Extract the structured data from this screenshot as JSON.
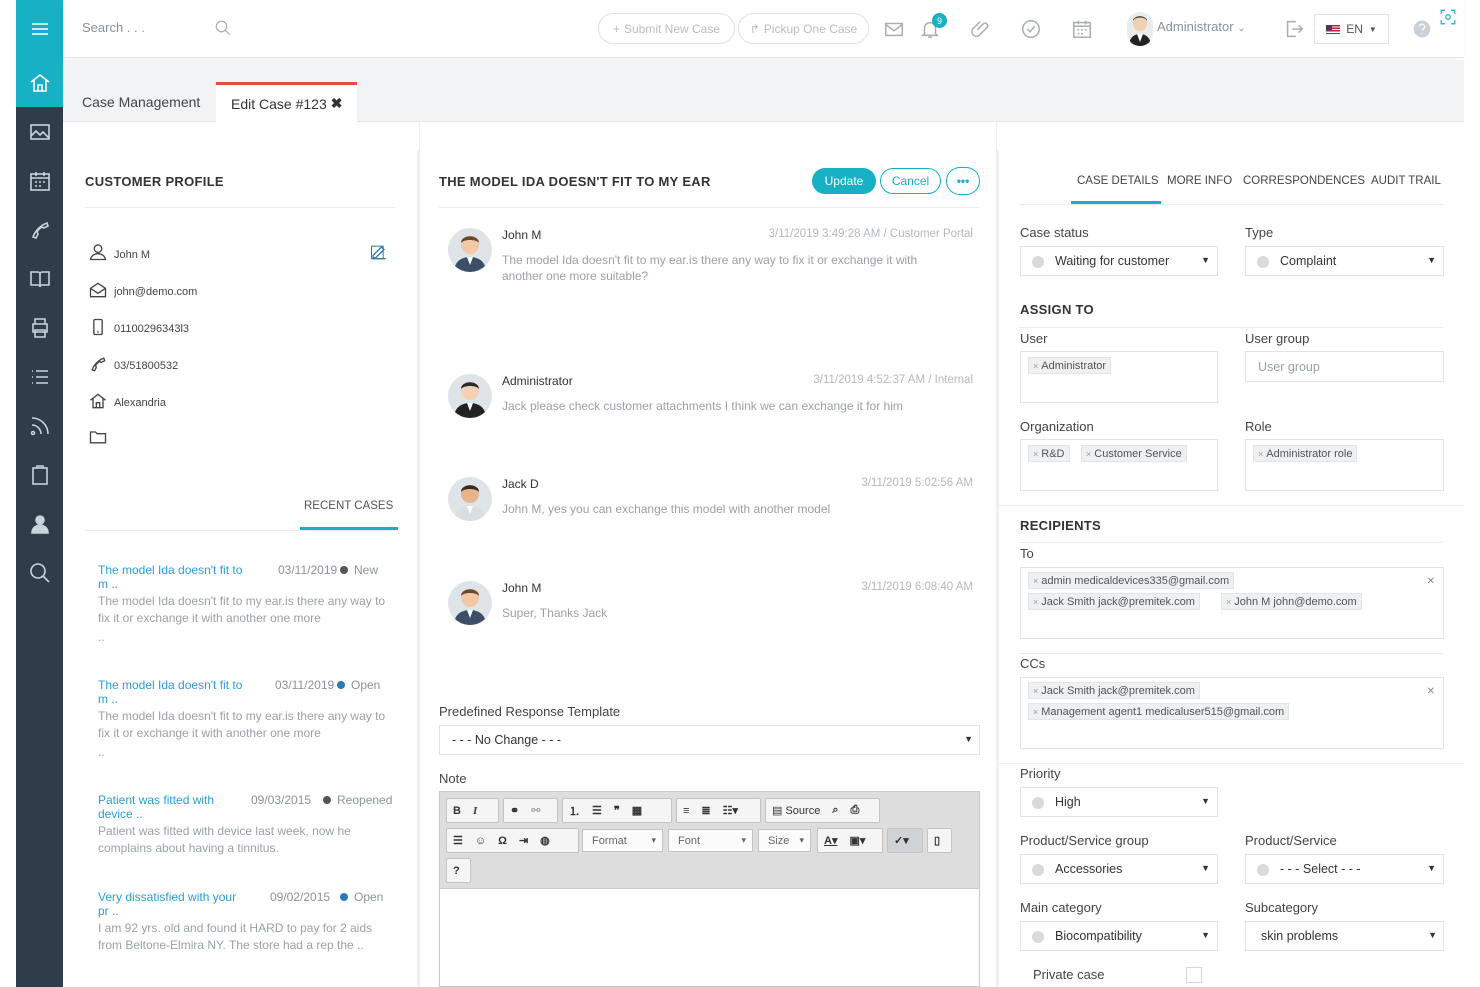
{
  "topbar": {
    "search_placeholder": "Search . . .",
    "submit_label": "Submit New Case",
    "pickup_label": "Pickup One Case",
    "notif_count": "9",
    "user_name": "Administrator",
    "language": "EN"
  },
  "tabs": {
    "case_management": "Case Management",
    "edit_case": "Edit Case #123",
    "edit_case_close": "✖"
  },
  "profile": {
    "title": "CUSTOMER PROFILE",
    "name": "John M",
    "email": "john@demo.com",
    "mobile": "01100296343l3",
    "phone": "03/51800532",
    "city": "Alexandria",
    "recent_tab": "RECENT CASES",
    "recent_cases": [
      {
        "title": "The model Ida doesn't fit to",
        "title2": "m ..",
        "date": "03/11/2019",
        "status": "New",
        "status_color": "#555555",
        "desc": "The model Ida doesn't fit to my ear.is there any way to fix it or exchange it with another one more",
        "desc_more": ".."
      },
      {
        "title": "The model Ida doesn't fit to",
        "title2": "m ..",
        "date": "03/11/2019",
        "status": "Open",
        "status_color": "#2a7ab8",
        "desc": "The model Ida doesn't fit to my ear.is there any way to fix it or exchange it with another one more",
        "desc_more": ".."
      },
      {
        "title": "Patient was fitted with",
        "title2": "device ..",
        "date": "09/03/2015",
        "status": "Reopened",
        "status_color": "#555555",
        "desc": "Patient was fitted with device last week, now he complains about having a tinnitus.",
        "desc_more": ""
      },
      {
        "title": "Very dissatisfied with your",
        "title2": "pr ..",
        "date": "09/02/2015",
        "status": "Open",
        "status_color": "#2a7ab8",
        "desc": "I am 92 yrs. old and found it HARD to pay for 2 aids from Beltone-Elmira NY. The store had a rep the ..",
        "desc_more": ""
      }
    ]
  },
  "case": {
    "title": "THE MODEL IDA DOESN'T FIT TO MY EAR",
    "update_label": "Update",
    "cancel_label": "Cancel",
    "more_label": "•••",
    "messages": [
      {
        "author": "John M",
        "meta": "3/11/2019 3:49:28 AM / Customer Portal",
        "text": "The model Ida doesn't fit to my ear.is there any way to fix it or exchange it with another one more suitable?"
      },
      {
        "author": "Administrator",
        "meta": "3/11/2019 4:52:37 AM / Internal",
        "text": "Jack please check customer attachments I think we can exchange it for him"
      },
      {
        "author": "Jack D",
        "meta": "3/11/2019 5:02:56 AM",
        "text": "John M, yes you can exchange this model with another model"
      },
      {
        "author": "John M",
        "meta": "3/11/2019 6:08:40 AM",
        "text": "Super, Thanks Jack"
      }
    ],
    "template_label": "Predefined Response Template",
    "template_value": "- - - No Change - - -",
    "note_label": "Note",
    "editor": {
      "source": "Source",
      "format": "Format",
      "font": "Font",
      "size": "Size"
    }
  },
  "details": {
    "tabs": [
      "CASE DETAILS",
      "MORE INFO",
      "CORRESPONDENCES",
      "AUDIT TRAIL"
    ],
    "case_status_label": "Case status",
    "case_status_value": "Waiting for customer",
    "type_label": "Type",
    "type_value": "Complaint",
    "assign_title": "ASSIGN TO",
    "user_label": "User",
    "user_chip": "Administrator",
    "user_group_label": "User group",
    "user_group_placeholder": "User group",
    "org_label": "Organization",
    "org_chips": [
      "R&D",
      "Customer Service"
    ],
    "role_label": "Role",
    "role_chip": "Administrator role",
    "recipients_title": "RECIPIENTS",
    "to_label": "To",
    "to_chips": [
      "admin medicaldevices335@gmail.com",
      "Jack Smith jack@premitek.com",
      "John M john@demo.com"
    ],
    "ccs_label": "CCs",
    "cc_chips": [
      "Jack Smith jack@premitek.com",
      "Management agent1 medicaluser515@gmail.com"
    ],
    "priority_label": "Priority",
    "priority_value": "High",
    "psg_label": "Product/Service group",
    "psg_value": "Accessories",
    "ps_label": "Product/Service",
    "ps_value": "- - - Select - - -",
    "main_cat_label": "Main category",
    "main_cat_value": "Biocompatibility",
    "subcat_label": "Subcategory",
    "subcat_value": "skin problems",
    "private_label": "Private case"
  },
  "colors": {
    "accent": "#17b0c4",
    "sidebar": "#2f3d4a",
    "tab_active": "#e74c3c",
    "link": "#2a9fd6"
  }
}
